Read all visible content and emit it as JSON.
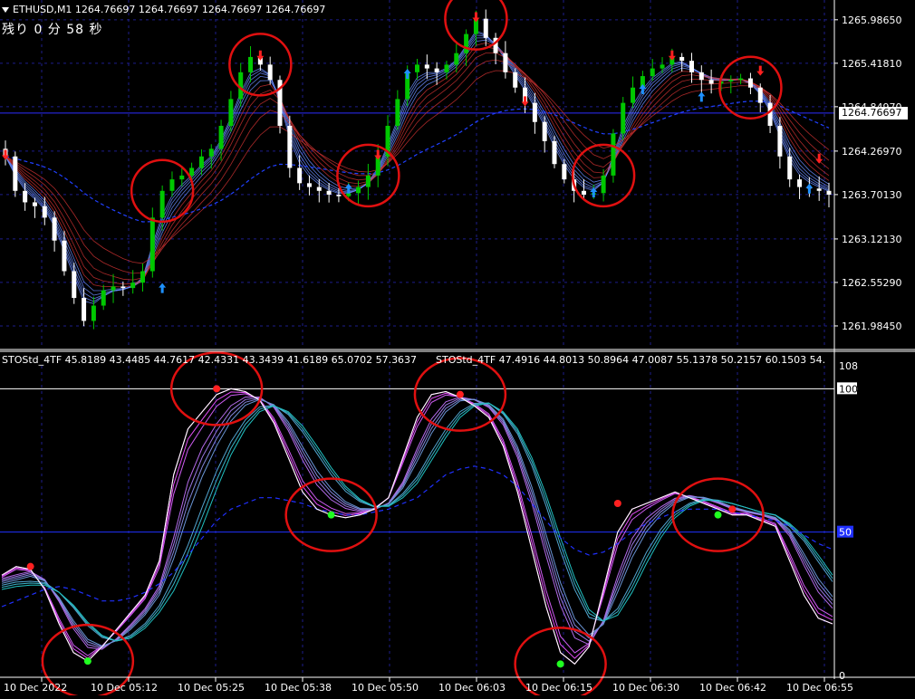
{
  "header": {
    "symbol_line": "ETHUSD,M1  1264.76697 1264.76697 1264.76697 1264.76697",
    "remaining": "残り 0 分 58 秒"
  },
  "indicator": {
    "label1": "STOStd_4TF 45.8189 43.4485 44.7617 42.4331 43.3439 41.6189 65.0702 57.3637",
    "label2": "STOStd_4TF 47.4916 44.8013 50.8964 47.0087 55.1378 50.2157 60.1503 54."
  },
  "current_price_label": "1264.76697",
  "colors": {
    "bull": "#00c800",
    "bear": "#ffffff",
    "grid": "#1e1e8c",
    "axis": "#ffffff",
    "circle": "#e01010",
    "up_arrow": "#1e90ff",
    "down_arrow": "#ff2020",
    "sto_main": "#ffffff",
    "sto_fan_a": "#ff40ff",
    "sto_fan_b": "#20c0c0",
    "level_line": "#2030ff",
    "current_price_line": "#2c2cff"
  },
  "chart_data": [
    {
      "type": "candlestick",
      "title": "ETHUSD,M1",
      "ylim": [
        1261.7,
        1266.15
      ],
      "y_ticks": [
        "1265.98650",
        "1265.41810",
        "1264.84970",
        "1264.26970",
        "1263.70130",
        "1263.12130",
        "1262.55290",
        "1261.98450"
      ],
      "y_tick_values": [
        1265.9865,
        1265.4181,
        1264.8497,
        1264.2697,
        1263.7013,
        1263.1213,
        1262.5529,
        1261.9845
      ],
      "current_price": 1264.76697,
      "x_labels": [
        "10 Dec 2022",
        "10 Dec 05:12",
        "10 Dec 05:25",
        "10 Dec 05:38",
        "10 Dec 05:50",
        "10 Dec 06:03",
        "10 Dec 06:15",
        "10 Dec 06:30",
        "10 Dec 06:42",
        "10 Dec 06:55"
      ],
      "close_path": [
        1264.2,
        1263.75,
        1263.6,
        1263.55,
        1263.4,
        1263.1,
        1262.7,
        1262.35,
        1262.05,
        1262.25,
        1262.45,
        1262.5,
        1262.48,
        1262.55,
        1262.7,
        1263.4,
        1263.75,
        1263.9,
        1263.95,
        1264.05,
        1264.2,
        1264.3,
        1264.6,
        1264.95,
        1265.3,
        1265.5,
        1265.4,
        1265.2,
        1264.6,
        1264.05,
        1263.85,
        1263.8,
        1263.75,
        1263.7,
        1263.68,
        1263.72,
        1263.8,
        1263.95,
        1264.2,
        1264.6,
        1264.95,
        1265.3,
        1265.4,
        1265.35,
        1265.3,
        1265.4,
        1265.55,
        1265.8,
        1266.0,
        1265.75,
        1265.55,
        1265.3,
        1265.1,
        1264.9,
        1264.65,
        1264.4,
        1264.1,
        1263.9,
        1263.75,
        1263.7,
        1263.72,
        1263.95,
        1264.5,
        1264.9,
        1265.1,
        1265.25,
        1265.35,
        1265.4,
        1265.5,
        1265.45,
        1265.3,
        1265.2,
        1265.15,
        1265.18,
        1265.2,
        1265.22,
        1265.1,
        1264.9,
        1264.6,
        1264.2,
        1263.9,
        1263.8,
        1263.78,
        1263.75,
        1263.7
      ],
      "up_arrows": [
        [
          16,
          1262.45
        ],
        [
          35,
          1263.75
        ],
        [
          41,
          1265.25
        ],
        [
          60,
          1263.7
        ],
        [
          65,
          1265.05
        ],
        [
          71,
          1264.95
        ],
        [
          82,
          1263.75
        ]
      ],
      "down_arrows": [
        [
          0,
          1264.25
        ],
        [
          26,
          1265.55
        ],
        [
          38,
          1264.25
        ],
        [
          48,
          1266.05
        ],
        [
          53,
          1264.95
        ],
        [
          68,
          1265.55
        ],
        [
          77,
          1265.35
        ],
        [
          83,
          1264.2
        ]
      ],
      "circled_bars": [
        16,
        26,
        37,
        48,
        61,
        76
      ]
    },
    {
      "type": "line",
      "title": "STOStd_4TF",
      "ylim": [
        0,
        108
      ],
      "y_ticks": [
        "108",
        "100",
        "50",
        "0"
      ],
      "y_tick_values": [
        108,
        100,
        50,
        0
      ],
      "level": 50,
      "x_labels": [
        "10 Dec 2022",
        "10 Dec 05:12",
        "10 Dec 05:25",
        "10 Dec 05:38",
        "10 Dec 05:50",
        "10 Dec 06:03",
        "10 Dec 06:15",
        "10 Dec 06:30",
        "10 Dec 06:42",
        "10 Dec 06:55"
      ],
      "main": [
        35,
        38,
        37,
        30,
        18,
        8,
        5,
        10,
        16,
        22,
        28,
        40,
        70,
        86,
        92,
        98,
        100,
        99,
        96,
        88,
        76,
        64,
        58,
        56,
        55,
        56,
        58,
        62,
        76,
        90,
        98,
        99,
        97,
        94,
        90,
        80,
        64,
        44,
        24,
        8,
        4,
        10,
        30,
        50,
        58,
        60,
        62,
        64,
        62,
        60,
        58,
        56,
        56,
        54,
        52,
        40,
        28,
        20,
        18
      ],
      "signal": [
        30,
        32,
        33,
        31,
        25,
        18,
        12,
        10,
        12,
        16,
        21,
        28,
        38,
        52,
        66,
        78,
        88,
        94,
        96,
        94,
        88,
        80,
        72,
        65,
        60,
        58,
        58,
        60,
        66,
        74,
        84,
        92,
        96,
        96,
        94,
        88,
        78,
        64,
        48,
        32,
        20,
        14,
        18,
        28,
        40,
        50,
        56,
        60,
        62,
        62,
        60,
        58,
        57,
        56,
        55,
        50,
        42,
        34,
        28
      ],
      "slow": [
        24,
        26,
        28,
        30,
        31,
        30,
        28,
        26,
        26,
        27,
        29,
        32,
        36,
        42,
        48,
        54,
        58,
        60,
        62,
        62,
        61,
        60,
        58,
        57,
        56,
        56,
        57,
        58,
        60,
        62,
        66,
        70,
        72,
        73,
        72,
        70,
        66,
        60,
        54,
        48,
        44,
        42,
        43,
        46,
        50,
        53,
        55,
        57,
        58,
        58,
        58,
        57,
        56,
        55,
        54,
        52,
        49,
        46,
        44
      ],
      "red_dots": [
        [
          2,
          38
        ],
        [
          15,
          100
        ],
        [
          32,
          98
        ],
        [
          43,
          60
        ],
        [
          51,
          58
        ]
      ],
      "green_dots": [
        [
          6,
          5
        ],
        [
          23,
          56
        ],
        [
          39,
          4
        ],
        [
          50,
          56
        ]
      ]
    }
  ]
}
